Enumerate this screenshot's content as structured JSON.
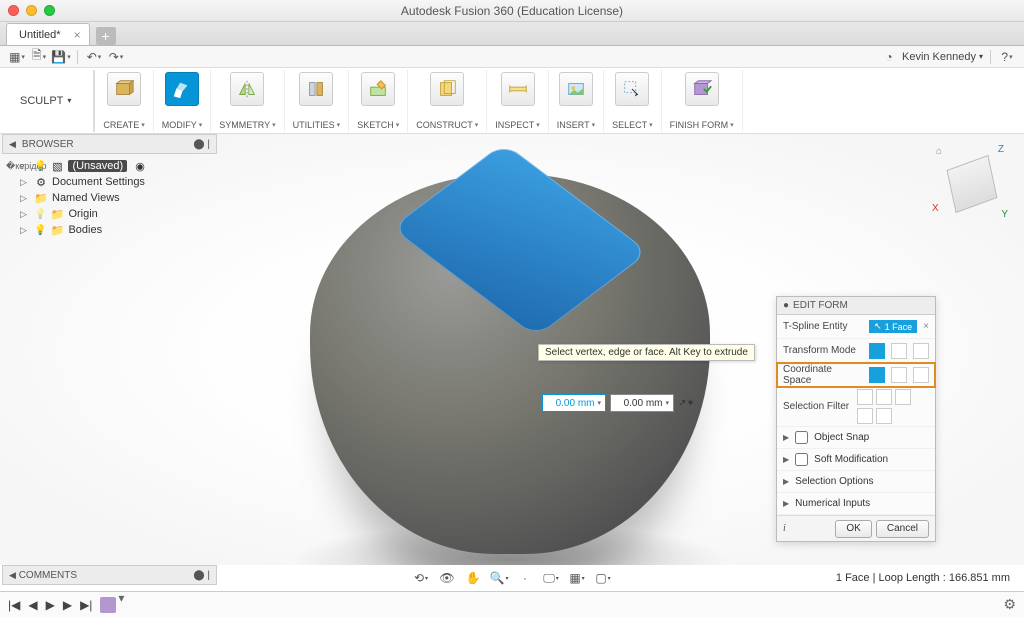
{
  "app_title": "Autodesk Fusion 360 (Education License)",
  "tab": {
    "title": "Untitled*"
  },
  "qat": {
    "username": "Kevin Kennedy"
  },
  "workspace": "SCULPT",
  "ribbon": [
    {
      "label": "CREATE",
      "icon": "create"
    },
    {
      "label": "MODIFY",
      "icon": "modify"
    },
    {
      "label": "SYMMETRY",
      "icon": "symmetry"
    },
    {
      "label": "UTILITIES",
      "icon": "utilities"
    },
    {
      "label": "SKETCH",
      "icon": "sketch"
    },
    {
      "label": "CONSTRUCT",
      "icon": "construct"
    },
    {
      "label": "INSPECT",
      "icon": "inspect"
    },
    {
      "label": "INSERT",
      "icon": "insert"
    },
    {
      "label": "SELECT",
      "icon": "select"
    },
    {
      "label": "FINISH FORM",
      "icon": "finish"
    }
  ],
  "browser": {
    "title": "BROWSER",
    "root": "(Unsaved)",
    "items": [
      "Document Settings",
      "Named Views",
      "Origin",
      "Bodies"
    ]
  },
  "tooltip": "Select vertex, edge or face. Alt Key to extrude",
  "dims": {
    "value1": "0.00 mm",
    "value2": "0.00 mm"
  },
  "panel": {
    "title": "EDIT FORM",
    "tspline_label": "T-Spline Entity",
    "tspline_value": "1 Face",
    "rows": [
      "Transform Mode",
      "Coordinate Space",
      "Selection Filter"
    ],
    "exp": [
      "Object Snap",
      "Soft Modification",
      "Selection Options",
      "Numerical Inputs"
    ],
    "ok": "OK",
    "cancel": "Cancel"
  },
  "comments": "COMMENTS",
  "status": "1 Face | Loop Length : 166.851 mm",
  "viewcube": {
    "z": "Z",
    "x": "X",
    "y": "Y"
  }
}
